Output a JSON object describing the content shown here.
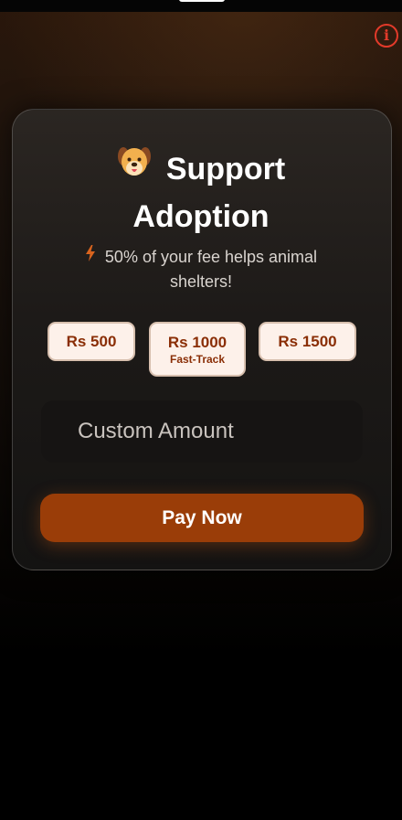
{
  "header": {
    "info_icon_glyph": "i",
    "info_icon_color": "#e23a2a"
  },
  "card": {
    "title_icon": "dog-face-icon",
    "title_line1": "Support",
    "title_line2": "Adoption",
    "subtitle_icon": "lightning-bolt-icon",
    "subtitle": "50% of your fee helps animal shelters!"
  },
  "amounts": [
    {
      "label": "Rs 500",
      "sublabel": ""
    },
    {
      "label": "Rs 1000",
      "sublabel": "Fast-Track"
    },
    {
      "label": "Rs 1500",
      "sublabel": ""
    }
  ],
  "custom_amount": {
    "placeholder": "Custom Amount"
  },
  "pay_button": {
    "label": "Pay Now",
    "color": "#9a3d08"
  },
  "colors": {
    "accent_text": "#8a2e06",
    "chip_bg": "#fdf1ea"
  }
}
